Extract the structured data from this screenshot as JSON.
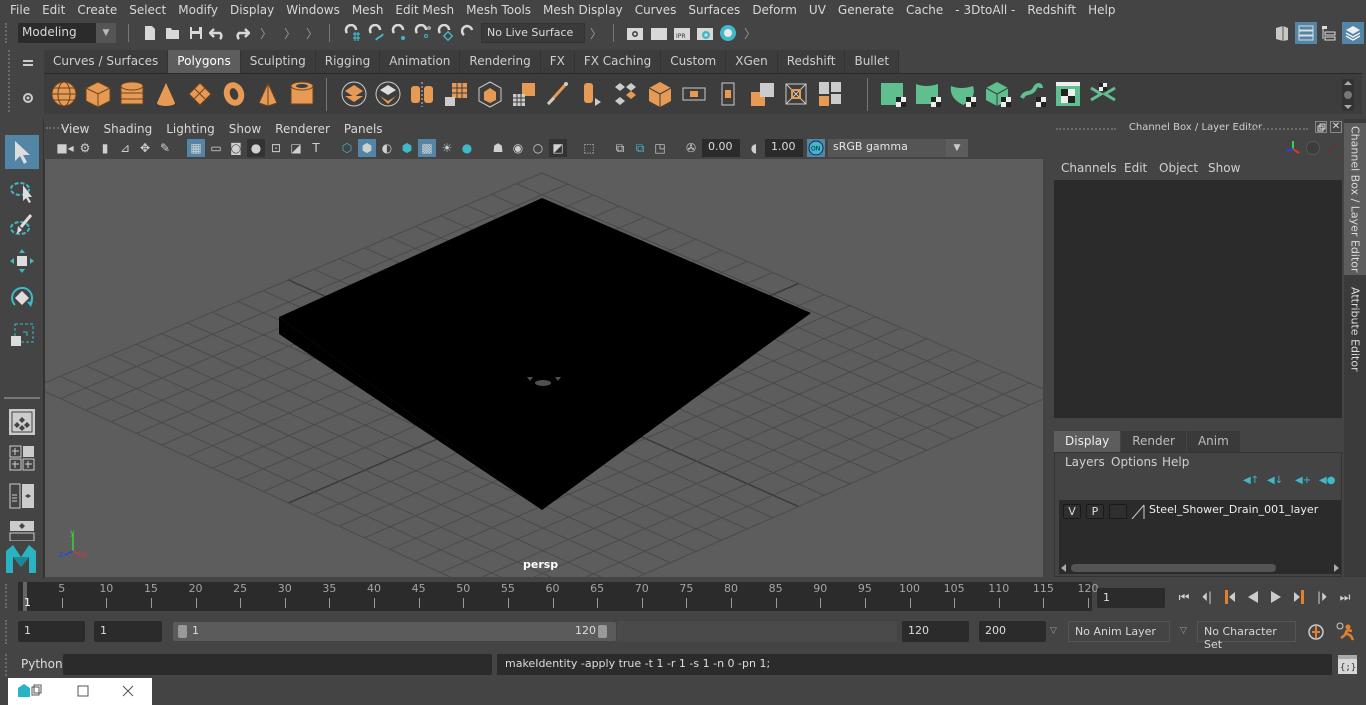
{
  "menubar": [
    "File",
    "Edit",
    "Create",
    "Select",
    "Modify",
    "Display",
    "Windows",
    "Mesh",
    "Edit Mesh",
    "Mesh Tools",
    "Mesh Display",
    "Curves",
    "Surfaces",
    "Deform",
    "UV",
    "Generate",
    "Cache",
    "- 3DtoAll -",
    "Redshift",
    "Help"
  ],
  "statusline": {
    "mode": "Modeling",
    "live_surface": "No Live Surface",
    "icons": [
      "new-scene-icon",
      "open-scene-icon",
      "save-scene-icon",
      "undo-icon",
      "redo-icon",
      "snap-grid-icon",
      "snap-curve-icon",
      "snap-point-icon",
      "snap-view-plane-icon",
      "snap-live-icon",
      "snap-magnet-icon",
      "render-view-icon",
      "render-frame-icon",
      "ipr-render-icon",
      "render-settings-icon",
      "hypershade-icon"
    ],
    "right_icons": [
      "modeling-toolkit-icon",
      "attribute-editor-icon",
      "tool-settings-icon",
      "channel-box-icon"
    ]
  },
  "shelf": {
    "tabs": [
      "Curves / Surfaces",
      "Polygons",
      "Sculpting",
      "Rigging",
      "Animation",
      "Rendering",
      "FX",
      "FX Caching",
      "Custom",
      "XGen",
      "Redshift",
      "Bullet"
    ],
    "active_tab": "Polygons",
    "icons": [
      "poly-sphere",
      "poly-cube",
      "poly-cylinder",
      "poly-cone",
      "poly-plane",
      "poly-torus",
      "poly-pyramid",
      "poly-pipe",
      "combine",
      "separate",
      "mirror",
      "smooth",
      "average-vertices",
      "subdivide",
      "bevel",
      "bridge",
      "extrude",
      "multi-cut",
      "bevel-edges",
      "extract",
      "target-weld",
      "insert-edge-loop",
      "append",
      "fill-hole",
      "planar-uv",
      "cylindrical-uv",
      "spherical-uv",
      "automatic-uv",
      "unfold-uv",
      "uv-editor",
      "cut-sew-uv"
    ],
    "colors": {
      "orange": "#e79a53",
      "green": "#5fbf8f"
    }
  },
  "toolbox": [
    "select-tool",
    "lasso-select-tool",
    "paint-select-tool",
    "move-tool",
    "rotate-tool",
    "scale-tool",
    "single-perspective-layout",
    "four-view-layout",
    "persp-outliner-layout",
    "persp-graph-layout"
  ],
  "viewport": {
    "menu": [
      "View",
      "Shading",
      "Lighting",
      "Show",
      "Renderer",
      "Panels"
    ],
    "exposure": "0.00",
    "gamma_value": "1.00",
    "color_mgmt": "ON",
    "color_space": "sRGB gamma",
    "camera_label": "persp",
    "axis": {
      "x": "x",
      "y": "y",
      "z": "z"
    },
    "background_color": "#5d5d5d"
  },
  "channelbox": {
    "title": "Channel Box / Layer Editor",
    "menu": [
      "Channels",
      "Edit",
      "Object",
      "Show"
    ],
    "layer_tabs": [
      "Display",
      "Render",
      "Anim"
    ],
    "active_layer_tab": "Display",
    "layer_menu": [
      "Layers",
      "Options",
      "Help"
    ],
    "layer": {
      "v": "V",
      "p": "P",
      "name": "Steel_Shower_Drain_001_layer"
    }
  },
  "side_tabs": [
    "Channel Box / Layer Editor",
    "Attribute Editor"
  ],
  "timeline": {
    "ticks": [
      5,
      10,
      15,
      20,
      25,
      30,
      35,
      40,
      45,
      50,
      55,
      60,
      65,
      70,
      75,
      80,
      85,
      90,
      95,
      100,
      105,
      110,
      115,
      120
    ],
    "start": 1,
    "end": 120,
    "current_frame_marker": "1",
    "current_frame": "1"
  },
  "range": {
    "start_field": "1",
    "playback_start": "1",
    "slider_min": "1",
    "slider_max": "120",
    "playback_end": "120",
    "end_field": "200",
    "anim_layer": "No Anim Layer",
    "character_set": "No Character Set"
  },
  "cmdline": {
    "language": "Python",
    "input": "",
    "result": "makeIdentity -apply true -t 1 -r 1 -s 1 -n 0 -pn 1;"
  }
}
